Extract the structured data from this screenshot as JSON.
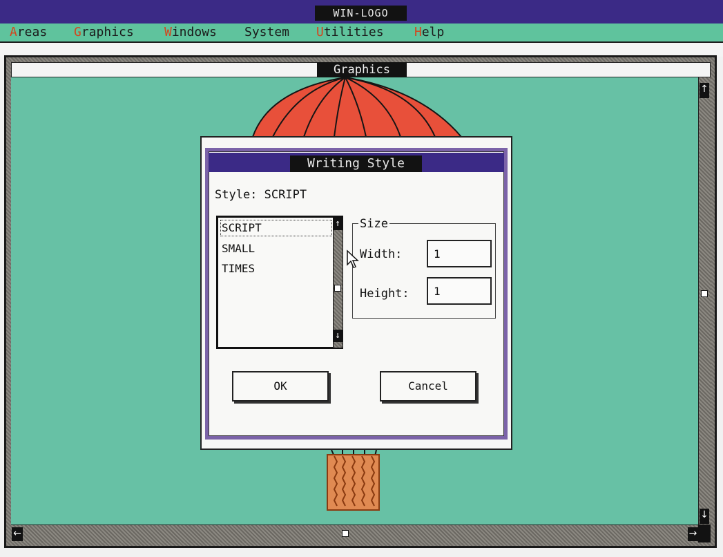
{
  "window": {
    "title": "WIN-LOGO"
  },
  "menu": [
    {
      "accel": "A",
      "rest": "reas"
    },
    {
      "accel": "G",
      "rest": "raphics"
    },
    {
      "accel": "W",
      "rest": "indows"
    },
    {
      "accel": "",
      "rest": "System"
    },
    {
      "accel": "U",
      "rest": "tilities"
    },
    {
      "accel": "H",
      "rest": "elp"
    }
  ],
  "graphics_window": {
    "title": "Graphics"
  },
  "dialog": {
    "title": "Writing Style",
    "style_label": "Style: SCRIPT",
    "styles": [
      "SCRIPT",
      "SMALL",
      "TIMES"
    ],
    "size_label": "Size",
    "width_label": "Width:",
    "width_value": "1",
    "height_label": "Height:",
    "height_value": "1",
    "ok_label": "OK",
    "cancel_label": "Cancel"
  },
  "icons": {
    "scroll_up": "↑",
    "scroll_down": "↓",
    "scroll_left": "←",
    "scroll_right": "→"
  },
  "colors": {
    "titlebar": "#3b2a86",
    "menubar": "#5fc39d",
    "canvas": "#67c1a5",
    "balloon": "#e8503a",
    "accelerator": "#d2461e"
  }
}
